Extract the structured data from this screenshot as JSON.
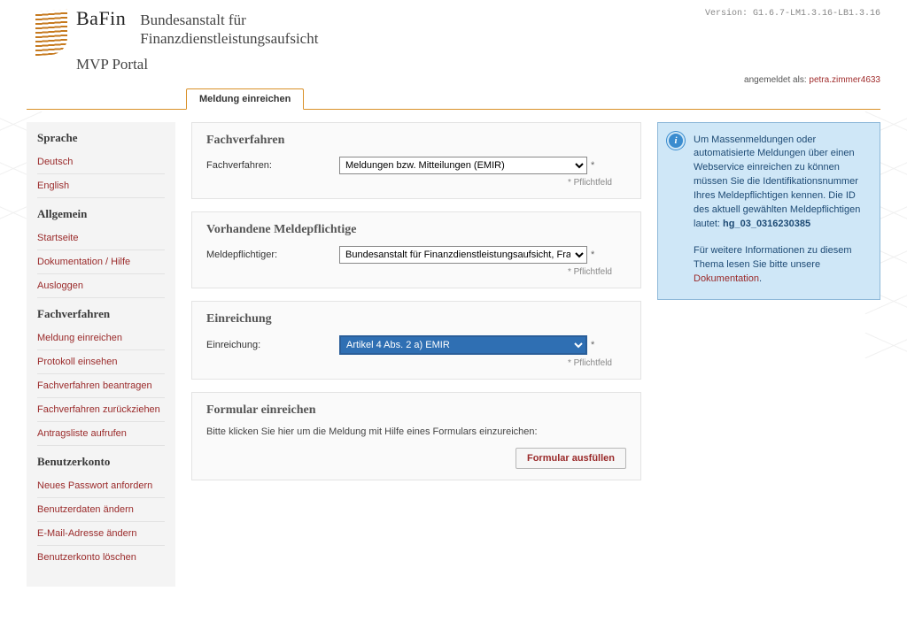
{
  "header": {
    "brand_short": "BaFin",
    "brand_full_line1": "Bundesanstalt für",
    "brand_full_line2": "Finanzdienstleistungsaufsicht",
    "portal_name": "MVP Portal",
    "version": "Version: G1.6.7-LM1.3.16-LB1.3.16"
  },
  "login": {
    "prefix": "angemeldet als: ",
    "user": "petra.zimmer4633"
  },
  "tab": {
    "active_label": "Meldung einreichen"
  },
  "sidebar": {
    "sprache": {
      "heading": "Sprache",
      "items": [
        "Deutsch",
        "English"
      ]
    },
    "allgemein": {
      "heading": "Allgemein",
      "items": [
        "Startseite",
        "Dokumentation / Hilfe",
        "Ausloggen"
      ]
    },
    "fachverfahren": {
      "heading": "Fachverfahren",
      "items": [
        "Meldung einreichen",
        "Protokoll einsehen",
        "Fachverfahren beantragen",
        "Fachverfahren zurückziehen",
        "Antragsliste aufrufen"
      ]
    },
    "benutzerkonto": {
      "heading": "Benutzerkonto",
      "items": [
        "Neues Passwort anfordern",
        "Benutzerdaten ändern",
        "E-Mail-Adresse ändern",
        "Benutzerkonto löschen"
      ]
    }
  },
  "panels": {
    "p1": {
      "title": "Fachverfahren",
      "field_label": "Fachverfahren:",
      "select_value": "Meldungen bzw. Mitteilungen (EMIR)",
      "required_hint": "* Pflichtfeld"
    },
    "p2": {
      "title": "Vorhandene Meldepflichtige",
      "field_label": "Meldepflichtiger:",
      "select_value": "Bundesanstalt für Finanzdienstleistungsaufsicht, Frankfurt",
      "required_hint": "* Pflichtfeld"
    },
    "p3": {
      "title": "Einreichung",
      "field_label": "Einreichung:",
      "select_value": "Artikel 4 Abs. 2 a) EMIR",
      "required_hint": "* Pflichtfeld"
    },
    "p4": {
      "title": "Formular einreichen",
      "instruction": "Bitte klicken Sie hier um die Meldung mit Hilfe eines Formulars einzureichen:",
      "button": "Formular ausfüllen"
    }
  },
  "info": {
    "text1a": "Um Massenmeldungen oder automatisierte Meldungen über einen Webservice einreichen zu können müssen Sie die Identifikationsnummer Ihres Meldepflichtigen kennen. Die ID des aktuell gewählten Meldepflichtigen lautet: ",
    "id_value": "hg_03_0316230385",
    "text2a": "Für weitere Informationen zu diesem Thema lesen Sie bitte unsere ",
    "doc_link": "Dokumentation",
    "period": "."
  },
  "asterisk": "*"
}
